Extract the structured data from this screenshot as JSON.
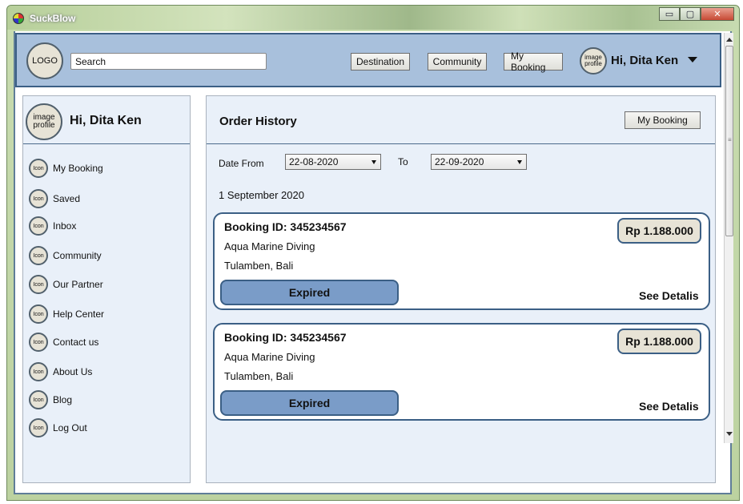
{
  "window": {
    "title": "SuckBlow",
    "controls": {
      "minimize": "▭",
      "maximize": "▢",
      "close": "✕"
    }
  },
  "header": {
    "logo": "LOGO",
    "search_placeholder": "Search",
    "nav": {
      "destination": "Destination",
      "community": "Community",
      "my_booking": "My Booking"
    },
    "avatar_label": "image profile",
    "greeting": "Hi, Dita Ken"
  },
  "sidebar": {
    "profile_label": "image profile",
    "profile_name": "Hi, Dita Ken",
    "icon_label": "Icon",
    "items": [
      {
        "label": "My Booking"
      },
      {
        "label": "Saved"
      },
      {
        "label": "Inbox"
      },
      {
        "label": "Community"
      },
      {
        "label": "Our Partner"
      },
      {
        "label": "Help Center"
      },
      {
        "label": "Contact us"
      },
      {
        "label": "About Us"
      },
      {
        "label": "Blog"
      },
      {
        "label": "Log Out"
      }
    ]
  },
  "main": {
    "title": "Order History",
    "my_booking_button": "My Booking",
    "filter": {
      "from_label": "Date From",
      "from_value": "22-08-2020",
      "to_label": "To",
      "to_value": "22-09-2020"
    },
    "date_heading": "1 September 2020",
    "orders": [
      {
        "booking_id": "Booking ID: 345234567",
        "name": "Aqua Marine Diving",
        "location": "Tulamben, Bali",
        "price": "Rp 1.188.000",
        "status": "Expired",
        "details": "See Detalis"
      },
      {
        "booking_id": "Booking ID: 345234567",
        "name": "Aqua Marine Diving",
        "location": "Tulamben, Bali",
        "price": "Rp 1.188.000",
        "status": "Expired",
        "details": "See Detalis"
      }
    ]
  },
  "colors": {
    "header_bg": "#a8c0dc",
    "panel_bg": "#e9f0f9",
    "accent_border": "#3b5f85",
    "status_bg": "#7a9cc8",
    "price_bg": "#e7e3d6"
  }
}
